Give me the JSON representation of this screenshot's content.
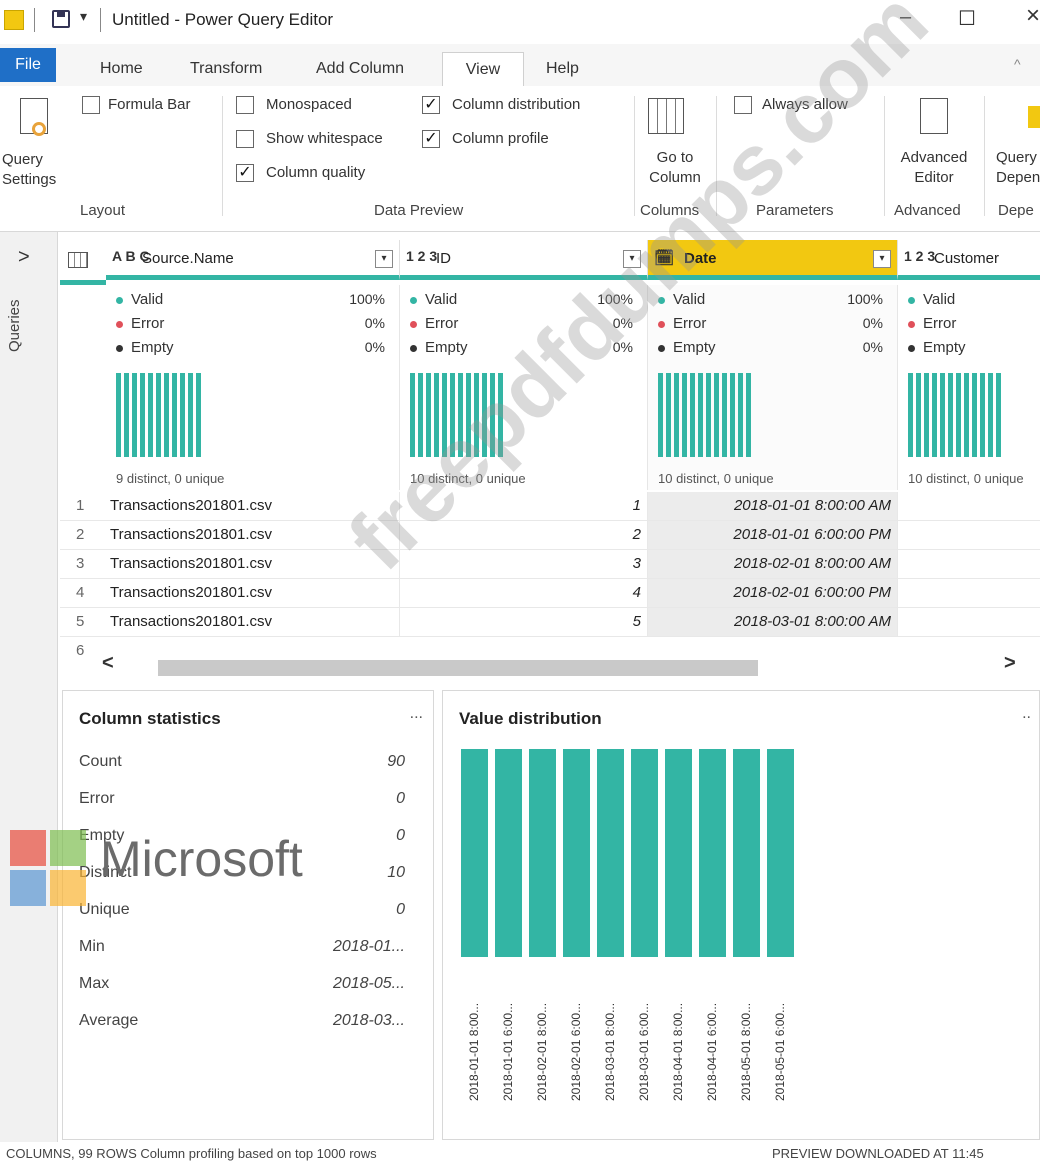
{
  "window": {
    "title": "Untitled - Power Query Editor",
    "minimize": "–",
    "maximize": "☐",
    "close": "×"
  },
  "tabs": [
    "File",
    "Home",
    "Transform",
    "Add Column",
    "View",
    "Help"
  ],
  "ribbon": {
    "query_settings": "Query Settings",
    "formula_bar": "Formula Bar",
    "monospaced": "Monospaced",
    "show_whitespace": "Show whitespace",
    "column_quality": "Column quality",
    "column_distribution": "Column distribution",
    "column_profile": "Column profile",
    "go_to_column": "Go to Column",
    "always_allow": "Always allow",
    "advanced_editor": "Advanced Editor",
    "query_dependencies": "Query Dependencies",
    "groups": {
      "layout": "Layout",
      "data_preview": "Data Preview",
      "columns": "Columns",
      "parameters": "Parameters",
      "advanced": "Advanced",
      "dependencies": "Depe"
    }
  },
  "queries_label": "Queries",
  "columns": [
    {
      "type": "A B C",
      "name": "Source.Name",
      "valid": "100%",
      "error": "0%",
      "empty": "0%",
      "distinct": "9 distinct, 0 unique"
    },
    {
      "type": "1 2 3",
      "name": "ID",
      "valid": "100%",
      "error": "0%",
      "empty": "0%",
      "distinct": "10 distinct, 0 unique"
    },
    {
      "type": "date",
      "name": "Date",
      "valid": "100%",
      "error": "0%",
      "empty": "0%",
      "distinct": "10 distinct, 0 unique"
    },
    {
      "type": "1 2 3",
      "name": "Customer",
      "valid": "",
      "error": "",
      "empty": "",
      "distinct": "10 distinct, 0 unique"
    }
  ],
  "profile_labels": {
    "valid": "Valid",
    "error": "Error",
    "empty": "Empty"
  },
  "rows": [
    {
      "n": "1",
      "source": "Transactions201801.csv",
      "id": "1",
      "date": "2018-01-01 8:00:00 AM"
    },
    {
      "n": "2",
      "source": "Transactions201801.csv",
      "id": "2",
      "date": "2018-01-01 6:00:00 PM"
    },
    {
      "n": "3",
      "source": "Transactions201801.csv",
      "id": "3",
      "date": "2018-02-01 8:00:00 AM"
    },
    {
      "n": "4",
      "source": "Transactions201801.csv",
      "id": "4",
      "date": "2018-02-01 6:00:00 PM"
    },
    {
      "n": "5",
      "source": "Transactions201801.csv",
      "id": "5",
      "date": "2018-03-01 8:00:00 AM"
    },
    {
      "n": "6",
      "source": "",
      "id": "",
      "date": ""
    }
  ],
  "scroll": {
    "left": "<",
    "right": ">"
  },
  "column_statistics": {
    "title": "Column statistics",
    "menu": "...",
    "items": [
      {
        "label": "Count",
        "value": "90"
      },
      {
        "label": "Error",
        "value": "0"
      },
      {
        "label": "Empty",
        "value": "0"
      },
      {
        "label": "Distinct",
        "value": "10"
      },
      {
        "label": "Unique",
        "value": "0"
      },
      {
        "label": "Min",
        "value": "2018-01..."
      },
      {
        "label": "Max",
        "value": "2018-05..."
      },
      {
        "label": "Average",
        "value": "2018-03..."
      }
    ]
  },
  "value_distribution": {
    "title": "Value distribution",
    "menu": "..",
    "bar_color": "#33b5a4",
    "labels": [
      "2018-01-01 8:00...",
      "2018-01-01 6:00...",
      "2018-02-01 8:00...",
      "2018-02-01 6:00...",
      "2018-03-01 8:00...",
      "2018-03-01 6:00...",
      "2018-04-01 8:00...",
      "2018-04-01 6:00...",
      "2018-05-01 8:00...",
      "2018-05-01 6:00..."
    ],
    "counts": [
      9,
      9,
      9,
      9,
      9,
      9,
      9,
      9,
      9,
      9
    ]
  },
  "status": {
    "left": "COLUMNS, 99 ROWS     Column profiling based on top 1000 rows",
    "right": "PREVIEW DOWNLOADED AT 11:45"
  },
  "watermark": "freepdfdumps.com",
  "logo_text": "Microsoft",
  "colors": {
    "accent": "#33b5a4",
    "selected_header": "#f2c811",
    "file_tab": "#1f6fc7"
  }
}
